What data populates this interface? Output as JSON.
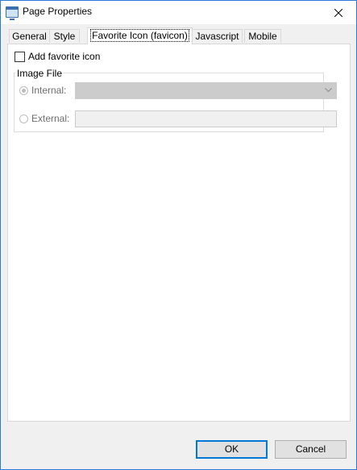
{
  "window": {
    "title": "Page Properties"
  },
  "tabs": [
    {
      "label": "General"
    },
    {
      "label": "Style"
    },
    {
      "label": "Favorite Icon (favicon)",
      "active": true
    },
    {
      "label": "Javascript"
    },
    {
      "label": "Mobile"
    }
  ],
  "favicon": {
    "add_label": "Add favorite icon",
    "add_checked": false,
    "group_title": "Image File",
    "internal_label": "Internal:",
    "internal_selected": true,
    "internal_value": "",
    "external_label": "External:",
    "external_value": ""
  },
  "buttons": {
    "ok": "OK",
    "cancel": "Cancel"
  },
  "colors": {
    "window_border": "#2b79d8",
    "default_button_border": "#0078d7",
    "disabled_text": "#6d6d6d"
  }
}
